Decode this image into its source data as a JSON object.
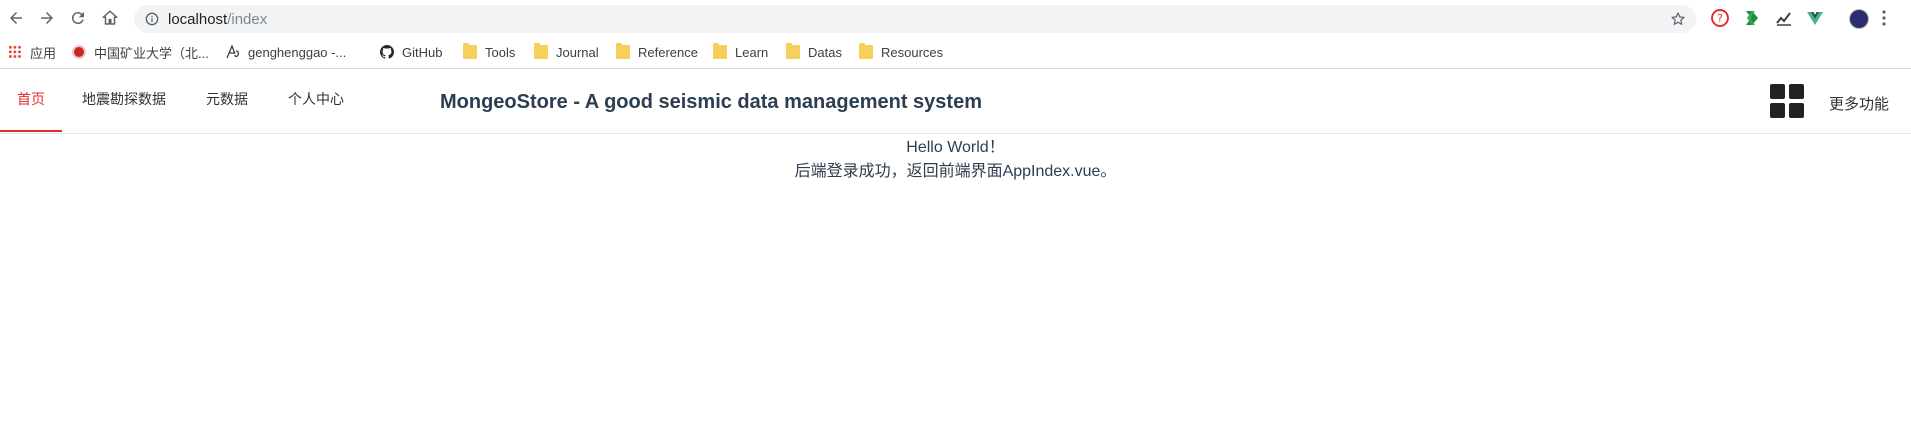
{
  "browser": {
    "url_host": "localhost",
    "url_path": "/index",
    "bookmarks": [
      {
        "label": "应用",
        "icon": "apps-grid-icon"
      },
      {
        "label": "中国矿业大学（北...",
        "icon": "university-logo-icon"
      },
      {
        "label": "genghenggao -...",
        "icon": "blog-logo-icon"
      },
      {
        "label": "GitHub",
        "icon": "github-icon"
      },
      {
        "label": "Tools",
        "icon": "folder-icon"
      },
      {
        "label": "Journal",
        "icon": "folder-icon"
      },
      {
        "label": "Reference",
        "icon": "folder-icon"
      },
      {
        "label": "Learn",
        "icon": "folder-icon"
      },
      {
        "label": "Datas",
        "icon": "folder-icon"
      },
      {
        "label": "Resources",
        "icon": "folder-icon"
      }
    ]
  },
  "app": {
    "nav": [
      {
        "label": "首页",
        "active": true
      },
      {
        "label": "地震勘探数据",
        "active": false
      },
      {
        "label": "元数据",
        "active": false
      },
      {
        "label": "个人中心",
        "active": false
      }
    ],
    "title": "MongeoStore - A good seismic data management system",
    "more_label": "更多功能",
    "accent": "#e62b2b"
  },
  "content": {
    "line1": "Hello World！",
    "line2": "后端登录成功，返回前端界面AppIndex.vue。"
  }
}
